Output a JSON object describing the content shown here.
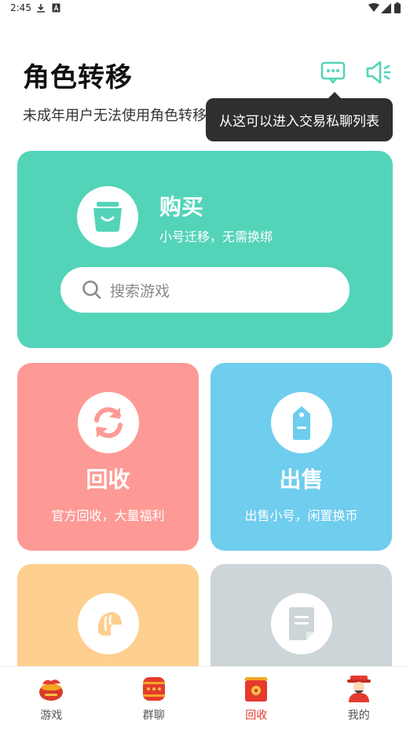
{
  "status_bar": {
    "time": "2:45"
  },
  "header": {
    "title": "角色转移",
    "subtitle": "未成年用户无法使用角色转移"
  },
  "tooltip": {
    "text": "从这可以进入交易私聊列表"
  },
  "buy_card": {
    "title": "购买",
    "description": "小号迁移，无需换绑",
    "search_placeholder": "搜索游戏",
    "color": "#53d4b9"
  },
  "tiles": [
    {
      "title": "回收",
      "description": "官方回收，大量福利",
      "color": "#fd9a95",
      "icon": "refresh-icon"
    },
    {
      "title": "出售",
      "description": "出售小号，闲置换币",
      "color": "#6fcdee",
      "icon": "price-tag-icon"
    },
    {
      "title": "",
      "description": "",
      "color": "#fecf8f",
      "icon": "helmet-icon"
    },
    {
      "title": "",
      "description": "",
      "color": "#ced5d9",
      "icon": "document-icon"
    }
  ],
  "accent_color": "#53d4b9",
  "bottom_nav": {
    "active": "回收",
    "items": [
      {
        "label": "游戏",
        "icon": "game-pot-icon"
      },
      {
        "label": "群聊",
        "icon": "drum-icon"
      },
      {
        "label": "回收",
        "icon": "red-envelope-icon"
      },
      {
        "label": "我的",
        "icon": "fortune-god-icon"
      }
    ]
  }
}
